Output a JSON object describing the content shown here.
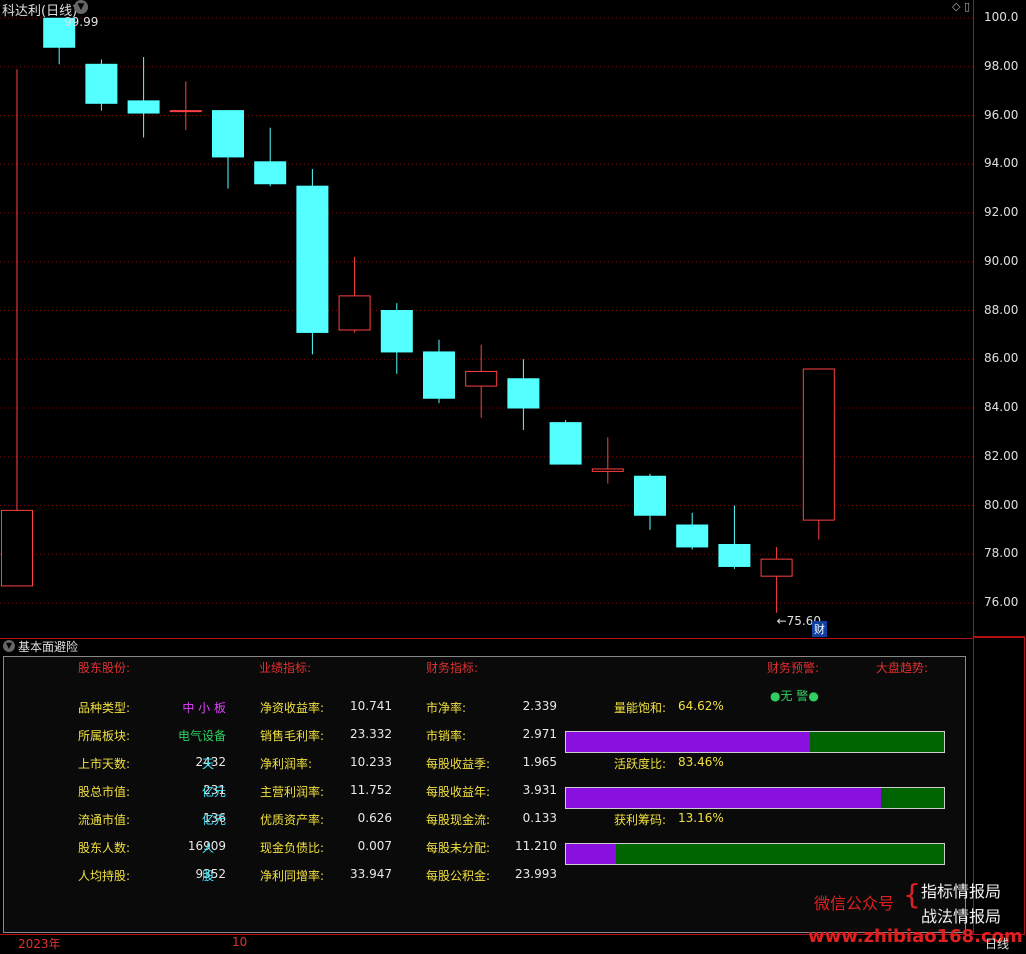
{
  "header": {
    "title": "科达利(日线)",
    "price_marker": "99.99"
  },
  "price_axis": {
    "ticks": [
      "100.0",
      "98.00",
      "96.00",
      "94.00",
      "92.00",
      "90.00",
      "88.00",
      "86.00",
      "84.00",
      "82.00",
      "80.00",
      "78.00",
      "76.00"
    ]
  },
  "chart_data": {
    "type": "candlestick",
    "ylim": [
      75.0,
      100.6
    ],
    "candles": [
      {
        "o": 76.7,
        "h": 97.9,
        "l": 77.6,
        "c": 79.8,
        "up": true
      },
      {
        "o": 98.8,
        "h": 99.99,
        "l": 98.1,
        "c": 99.99,
        "up": false
      },
      {
        "o": 98.1,
        "h": 98.3,
        "l": 96.2,
        "c": 96.5,
        "up": false
      },
      {
        "o": 96.6,
        "h": 98.4,
        "l": 95.1,
        "c": 96.1,
        "up": false
      },
      {
        "o": 96.2,
        "h": 97.4,
        "l": 95.4,
        "c": 96.2,
        "up": true
      },
      {
        "o": 96.2,
        "h": 96.2,
        "l": 93.0,
        "c": 94.3,
        "up": false
      },
      {
        "o": 94.1,
        "h": 95.5,
        "l": 93.1,
        "c": 93.2,
        "up": false
      },
      {
        "o": 93.1,
        "h": 93.8,
        "l": 86.2,
        "c": 87.1,
        "up": false
      },
      {
        "o": 87.2,
        "h": 90.2,
        "l": 87.1,
        "c": 88.6,
        "up": true
      },
      {
        "o": 88.0,
        "h": 88.3,
        "l": 85.4,
        "c": 86.3,
        "up": false
      },
      {
        "o": 86.3,
        "h": 86.8,
        "l": 84.2,
        "c": 84.4,
        "up": false
      },
      {
        "o": 84.9,
        "h": 86.6,
        "l": 83.6,
        "c": 85.5,
        "up": true
      },
      {
        "o": 85.2,
        "h": 86.0,
        "l": 83.1,
        "c": 84.0,
        "up": false
      },
      {
        "o": 83.4,
        "h": 83.5,
        "l": 81.7,
        "c": 81.7,
        "up": false
      },
      {
        "o": 81.4,
        "h": 82.8,
        "l": 80.9,
        "c": 81.5,
        "up": true
      },
      {
        "o": 81.2,
        "h": 81.3,
        "l": 79.0,
        "c": 79.6,
        "up": false
      },
      {
        "o": 79.2,
        "h": 79.7,
        "l": 78.2,
        "c": 78.3,
        "up": false
      },
      {
        "o": 78.4,
        "h": 80.0,
        "l": 77.4,
        "c": 77.5,
        "up": false
      },
      {
        "o": 77.1,
        "h": 78.3,
        "l": 75.6,
        "c": 77.8,
        "up": true
      },
      {
        "o": 79.4,
        "h": 85.6,
        "l": 78.6,
        "c": 85.6,
        "up": true
      }
    ],
    "low_label": "75.60",
    "high_label": "99.99"
  },
  "badges": {
    "finance": "财"
  },
  "panel": {
    "title": "基本面避险",
    "headers": {
      "shareholders": "股东股份:",
      "performance": "业绩指标:",
      "financial": "财务指标:",
      "warning": "财务预警:",
      "market": "大盘趋势:"
    },
    "warning_value": "无 警",
    "col1": [
      {
        "label": "品种类型:",
        "value": "中 小 板",
        "unit": ""
      },
      {
        "label": "所属板块:",
        "value": "电气设备",
        "unit": ""
      },
      {
        "label": "上市天数:",
        "value": "2432",
        "unit": "天"
      },
      {
        "label": "股总市值:",
        "value": "231",
        "unit": "亿元"
      },
      {
        "label": "流通市值:",
        "value": "136",
        "unit": "亿元"
      },
      {
        "label": "股东人数:",
        "value": "16909",
        "unit": "人"
      },
      {
        "label": "人均持股:",
        "value": "9352",
        "unit": "股"
      }
    ],
    "col2": [
      {
        "label": "净资收益率:",
        "value": "10.741"
      },
      {
        "label": "销售毛利率:",
        "value": "23.332"
      },
      {
        "label": "净利润率:",
        "value": "10.233"
      },
      {
        "label": "主营利润率:",
        "value": "11.752"
      },
      {
        "label": "优质资产率:",
        "value": "0.626"
      },
      {
        "label": "现金负债比:",
        "value": "0.007"
      },
      {
        "label": "净利同增率:",
        "value": "33.947"
      }
    ],
    "col3": [
      {
        "label": "市净率:",
        "value": "2.339"
      },
      {
        "label": "市销率:",
        "value": "2.971"
      },
      {
        "label": "每股收益季:",
        "value": "1.965"
      },
      {
        "label": "每股收益年:",
        "value": "3.931"
      },
      {
        "label": "每股现金流:",
        "value": "0.133"
      },
      {
        "label": "每股未分配:",
        "value": "11.210"
      },
      {
        "label": "每股公积金:",
        "value": "23.993"
      }
    ],
    "bars": [
      {
        "label": "量能饱和:",
        "value": "64.62%",
        "fraction": 0.6462
      },
      {
        "label": "活跃度比:",
        "value": "83.46%",
        "fraction": 0.8346
      },
      {
        "label": "获利筹码:",
        "value": "13.16%",
        "fraction": 0.1316
      }
    ]
  },
  "bottom_axis": {
    "year": "2023年",
    "month": "10",
    "period": "日线"
  },
  "watermark": {
    "wechat": "微信公众号",
    "brace": "{",
    "line1": "指标情报局",
    "line2": "战法情报局",
    "site": "www.zhibiao168.com"
  },
  "colors": {
    "up": "#ff4040",
    "down": "#54ffff",
    "grid": "#7a0a0a",
    "bar_fill": "#8a10e0",
    "bar_bg": "#006400"
  }
}
